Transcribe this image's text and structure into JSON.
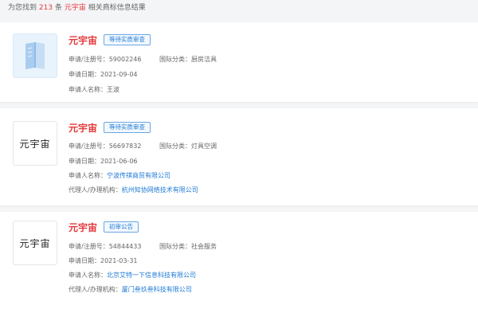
{
  "summary": {
    "prefix": "为您找到",
    "count": "213",
    "unit": "条",
    "keyword": "元宇宙",
    "suffix": "相关商标信息结果"
  },
  "results": [
    {
      "logo_type": "image",
      "logo_icon": "book-icon",
      "name": "元宇宙",
      "status": "等待实质审查",
      "reg_label": "申请/注册号：",
      "reg_no": "59002246",
      "class_label": "国际分类：",
      "class_value": "厨房洁具",
      "date_label": "申请日期：",
      "date": "2021-09-04",
      "applicant_label": "申请人名称：",
      "applicant": "王波"
    },
    {
      "logo_type": "text",
      "logo_text": "元宇宙",
      "name": "元宇宙",
      "status": "等待实质审查",
      "reg_label": "申请/注册号：",
      "reg_no": "56697832",
      "class_label": "国际分类：",
      "class_value": "灯具空调",
      "date_label": "申请日期：",
      "date": "2021-06-06",
      "applicant_label": "申请人名称：",
      "applicant": "宁波传祺商贸有限公司",
      "agent_label": "代理人/办理机构：",
      "agent": "杭州知协网络技术有限公司"
    },
    {
      "logo_type": "text",
      "logo_text": "元宇宙",
      "name": "元宇宙",
      "status": "初审公告",
      "reg_label": "申请/注册号：",
      "reg_no": "54844433",
      "class_label": "国际分类：",
      "class_value": "社会服务",
      "date_label": "申请日期：",
      "date": "2021-03-31",
      "applicant_label": "申请人名称：",
      "applicant": "北京艾特一下信息科技有限公司",
      "agent_label": "代理人/办理机构：",
      "agent": "厦门叁玖叁科技有限公司"
    }
  ],
  "colors": {
    "accent_red": "#e4393c",
    "link_blue": "#1e7ad6",
    "background": "#f4f5f7"
  }
}
